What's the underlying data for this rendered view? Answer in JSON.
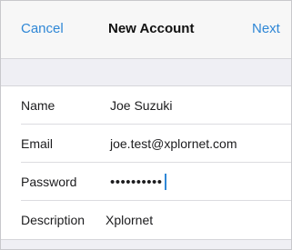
{
  "navbar": {
    "cancel_label": "Cancel",
    "title": "New Account",
    "next_label": "Next"
  },
  "form": {
    "fields": [
      {
        "label": "Name",
        "value": "Joe Suzuki"
      },
      {
        "label": "Email",
        "value": "joe.test@xplornet.com"
      },
      {
        "label": "Password",
        "value": "••••••••••"
      },
      {
        "label": "Description",
        "value": "Xplornet"
      }
    ]
  },
  "colors": {
    "accent": "#2f87d6",
    "background": "#efeff4"
  }
}
